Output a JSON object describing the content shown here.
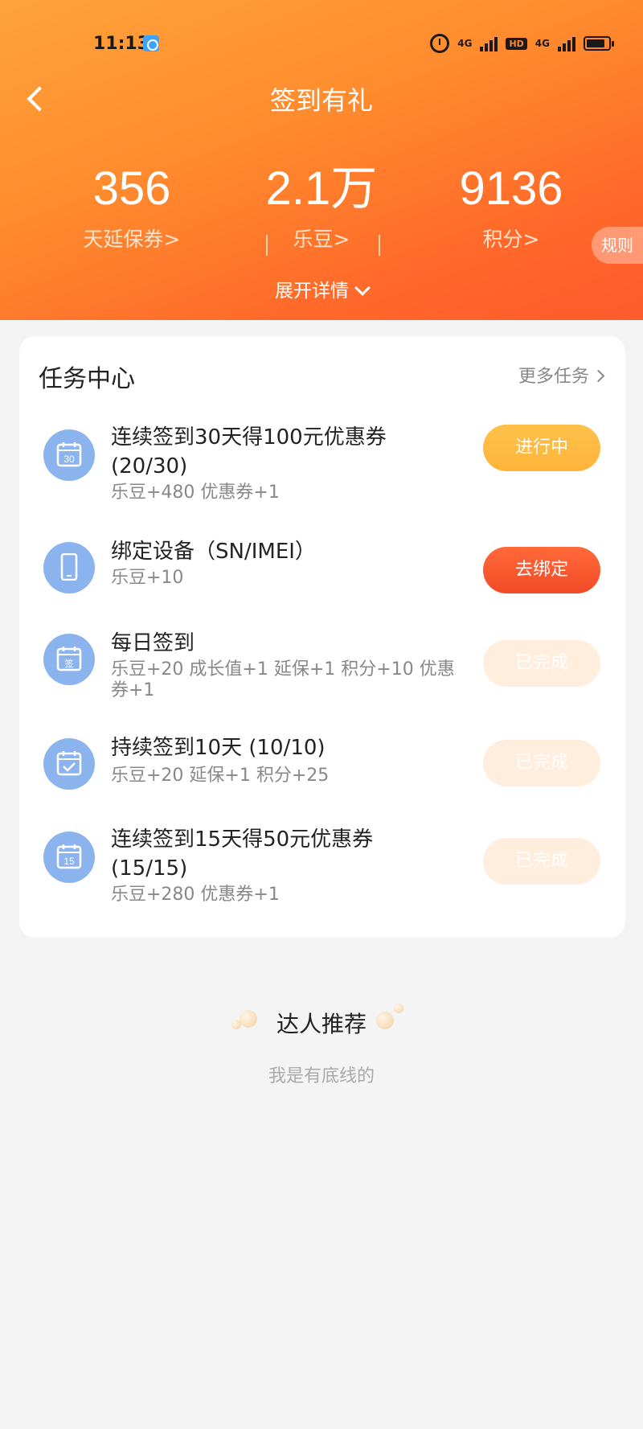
{
  "status_bar": {
    "time": "11:13",
    "network1": "4G",
    "hd": "HD",
    "network2": "4G"
  },
  "header": {
    "title": "签到有礼",
    "stats": [
      {
        "value": "356",
        "label": "天延保券>"
      },
      {
        "value": "2.1万",
        "label": "乐豆>"
      },
      {
        "value": "9136",
        "label": "积分>"
      }
    ],
    "rules": "规则",
    "expand": "展开详情"
  },
  "task_center": {
    "title": "任务中心",
    "more": "更多任务",
    "tasks": [
      {
        "icon": "calendar-30-icon",
        "title": "连续签到30天得100元优惠券 (20/30)",
        "reward": "乐豆+480 优惠券+1",
        "button": "进行中",
        "state": "in-progress"
      },
      {
        "icon": "phone-icon",
        "title": "绑定设备（SN/IMEI）",
        "reward": "乐豆+10",
        "button": "去绑定",
        "state": "action"
      },
      {
        "icon": "calendar-sign-icon",
        "title": "每日签到",
        "reward": "乐豆+20 成长值+1 延保+1 积分+10 优惠券+1",
        "button": "已完成",
        "state": "done"
      },
      {
        "icon": "calendar-check-icon",
        "title": "持续签到10天 (10/10)",
        "reward": "乐豆+20 延保+1 积分+25",
        "button": "已完成",
        "state": "done"
      },
      {
        "icon": "calendar-15-icon",
        "title": "连续签到15天得50元优惠券 (15/15)",
        "reward": "乐豆+280 优惠券+1",
        "button": "已完成",
        "state": "done"
      }
    ]
  },
  "recommend": {
    "title": "达人推荐",
    "subtitle": "我是有底线的"
  },
  "colors": {
    "header_start": "#ffa33a",
    "header_end": "#ff5a2c",
    "icon_bg": "#8bb4ee",
    "btn_progress": "#ffb43a",
    "btn_bind": "#f24b26",
    "btn_done": "#ffeedd"
  }
}
